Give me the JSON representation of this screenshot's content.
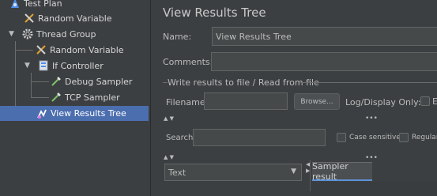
{
  "tree": {
    "items": [
      {
        "label": "Test Plan",
        "icon": "test-plan-icon"
      },
      {
        "label": "Random Variable",
        "icon": "random-variable-icon"
      },
      {
        "label": "Thread Group",
        "icon": "gear-icon"
      },
      {
        "label": "Random Variable",
        "icon": "random-variable-icon"
      },
      {
        "label": "If Controller",
        "icon": "if-controller-icon"
      },
      {
        "label": "Debug Sampler",
        "icon": "pipette-icon"
      },
      {
        "label": "TCP Sampler",
        "icon": "pipette-icon"
      },
      {
        "label": "View Results Tree",
        "icon": "listener-icon"
      }
    ]
  },
  "panel": {
    "title": "View Results Tree",
    "name_label": "Name:",
    "name_value": "View Results Tree",
    "comments_label": "Comments:",
    "comments_value": "",
    "write_results_label": "Write results to file / Read from file",
    "filename_label": "Filename",
    "filename_value": "",
    "browse_label": "Browse...",
    "log_display_label": "Log/Display Only:",
    "log_display_partial": "E",
    "search_label": "Search:",
    "search_value": "",
    "case_sensitive_label": "Case sensitive",
    "regular_label": "Regular",
    "renderer_select_value": "Text",
    "sampler_result_tab": "Sampler result"
  },
  "colors": {
    "background": "#3c3f41",
    "selection": "#4b6eaf",
    "field": "#45494a"
  }
}
